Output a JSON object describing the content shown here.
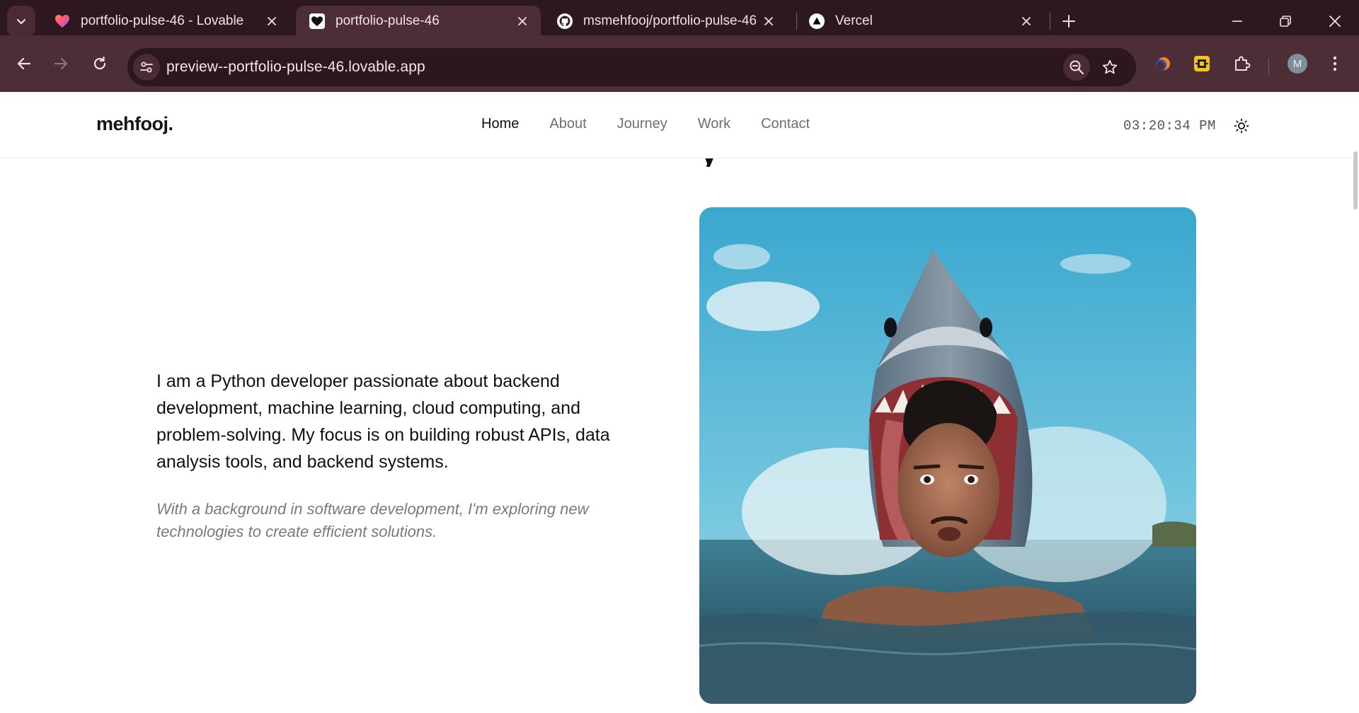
{
  "browser": {
    "tabs": [
      {
        "title": "portfolio-pulse-46 - Lovable",
        "icon": "lovable-heart-icon",
        "active": false
      },
      {
        "title": "portfolio-pulse-46",
        "icon": "heart-icon",
        "active": true
      },
      {
        "title": "msmehfooj/portfolio-pulse-46",
        "icon": "github-icon",
        "active": false
      },
      {
        "title": "Vercel",
        "icon": "vercel-icon",
        "active": false
      }
    ],
    "url": "preview--portfolio-pulse-46.lovable.app",
    "profile_initial": "M",
    "colors": {
      "frame": "#2e1820",
      "toolbar": "#4d2d36",
      "omnibox": "#2b171d"
    }
  },
  "site": {
    "brand": "mehfooj.",
    "nav": [
      {
        "label": "Home",
        "current": true
      },
      {
        "label": "About",
        "current": false
      },
      {
        "label": "Journey",
        "current": false
      },
      {
        "label": "Work",
        "current": false
      },
      {
        "label": "Contact",
        "current": false
      }
    ],
    "clock": "03:20:34 PM",
    "theme_icon": "sun-icon"
  },
  "about": {
    "intro": "I am a Python developer passionate about backend development, machine learning, cloud computing, and problem-solving. My focus is on building robust APIs, data analysis tools, and backend systems.",
    "sub": "With a background in software development, I'm exploring new technologies to create efficient solutions."
  }
}
